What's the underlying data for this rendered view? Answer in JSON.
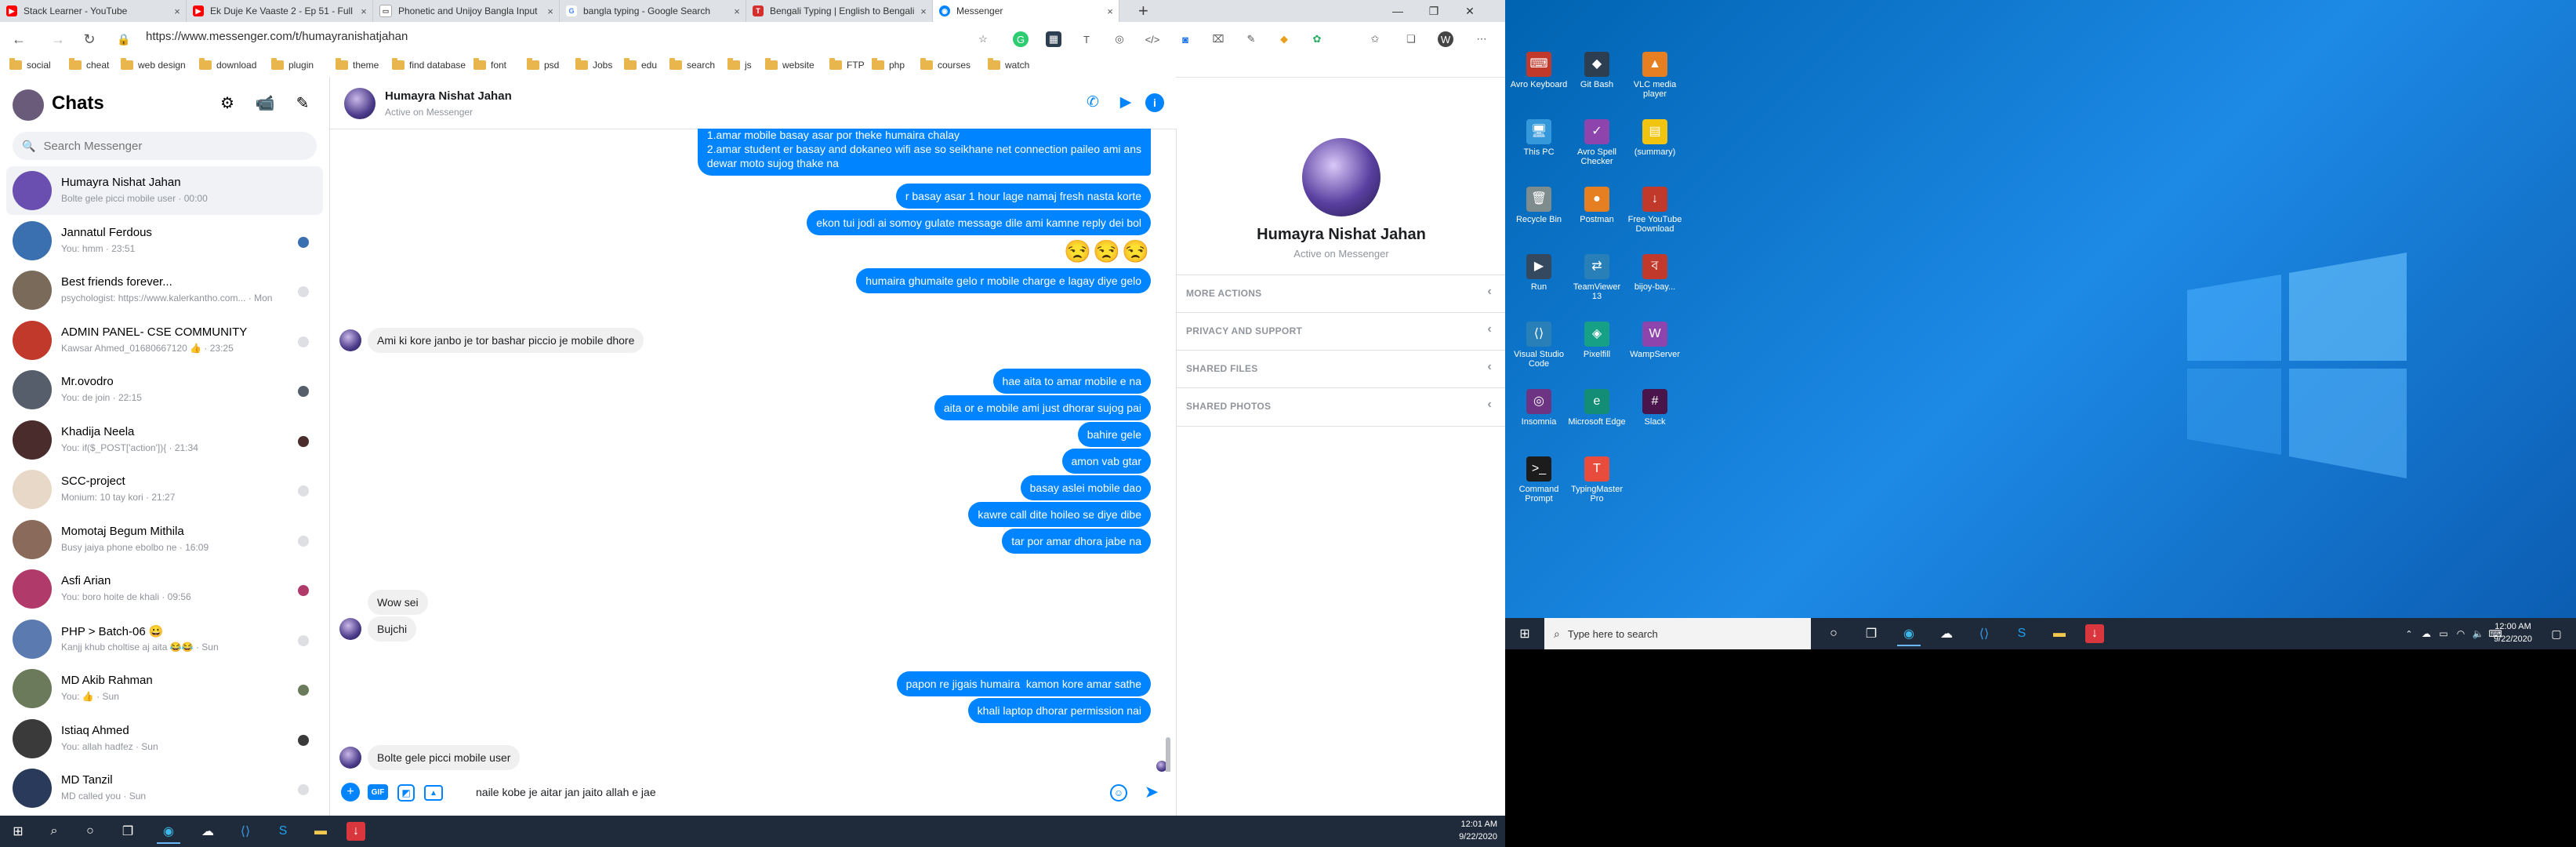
{
  "browser": {
    "tabs": [
      {
        "title": "Stack Learner - YouTube",
        "color": "#ff0000",
        "glyph": "▶"
      },
      {
        "title": "Ek Duje Ke Vaaste 2 - Ep 51 - Full",
        "color": "#ff0000",
        "glyph": "▶"
      },
      {
        "title": "Phonetic and Unijoy Bangla Input",
        "color": "#ffffff",
        "glyph": "📄"
      },
      {
        "title": "bangla typing - Google Search",
        "color": "#ffffff",
        "glyph": "G"
      },
      {
        "title": "Bengali Typing | English to Bengali",
        "color": "#d32f2f",
        "glyph": "T"
      },
      {
        "title": "Messenger",
        "color": "#0084ff",
        "glyph": "◉"
      }
    ],
    "url": "https://www.messenger.com/t/humayranishatjahan",
    "bookmarks": [
      "social",
      "cheat",
      "web design",
      "download",
      "plugin",
      "theme",
      "find database",
      "font",
      "psd",
      "Jobs",
      "edu",
      "search",
      "js",
      "website",
      "FTP",
      "php",
      "courses",
      "watch"
    ]
  },
  "sidebar": {
    "title": "Chats",
    "search_placeholder": "Search Messenger",
    "conversations": [
      {
        "name": "Humayra Nishat Jahan",
        "preview": "Bolte gele picci mobile user · 00:00",
        "avatar_color": "#6a4fb0"
      },
      {
        "name": "Jannatul Ferdous",
        "preview": "You: hmm · 23:51",
        "avatar_color": "#3a6fb0"
      },
      {
        "name": "Best friends forever...",
        "preview": "psychologist: https://www.kalerkantho.com... · Mon",
        "avatar_color": "#7a6a5a"
      },
      {
        "name": "ADMIN PANEL- CSE COMMUNITY",
        "preview": "Kawsar Ahmed_01680667120 👍 · 23:25",
        "avatar_color": "#c0392b"
      },
      {
        "name": "Mr.ovodro",
        "preview": "You: de join · 22:15",
        "avatar_color": "#555e6a"
      },
      {
        "name": "Khadija Neela",
        "preview": "You: if($_POST['action']){ · 21:34",
        "avatar_color": "#4a2c2c"
      },
      {
        "name": "SCC-project",
        "preview": "Monium: 10 tay kori · 21:27",
        "avatar_color": "#e8d8c8"
      },
      {
        "name": "Momotaj Begum Mithila",
        "preview": "Busy jaiya phone ebolbo ne · 16:09",
        "avatar_color": "#8a6a5a"
      },
      {
        "name": "Asfi Arian",
        "preview": "You: boro hoite de khali · 09:56",
        "avatar_color": "#b03a6a"
      },
      {
        "name": "PHP > Batch-06 😀",
        "preview": "Kanjj khub choltise aj aita 😂😂 · Sun",
        "avatar_color": "#5a7ab0"
      },
      {
        "name": "MD Akib Rahman",
        "preview": "You: 👍 · Sun",
        "avatar_color": "#6a7a5a"
      },
      {
        "name": "Istiaq Ahmed",
        "preview": "You: allah hadfez · Sun",
        "avatar_color": "#3a3a3a"
      },
      {
        "name": "MD Tanzil",
        "preview": "MD called you · Sun",
        "avatar_color": "#2a3a5a"
      }
    ]
  },
  "chat": {
    "name": "Humayra Nishat Jahan",
    "status": "Active on Messenger",
    "messages": [
      {
        "dir": "out",
        "text": "1.amar mobile basay asar por theke humaira chalay\n2.amar student er basay and dokaneo wifi ase so seikhane net connection paileo ami ans\ndewar moto sujog thake na"
      },
      {
        "dir": "out",
        "text": "r basay asar 1 hour lage namaj fresh nasta korte"
      },
      {
        "dir": "out",
        "text": "ekon tui jodi ai somoy gulate message dile ami kamne reply dei bol"
      },
      {
        "dir": "out",
        "text": "😒😒😒"
      },
      {
        "dir": "out",
        "text": "humaira ghumaite gelo r mobile charge e lagay diye gelo"
      },
      {
        "dir": "in",
        "text": "Ami ki kore janbo je tor bashar piccio je mobile dhore"
      },
      {
        "dir": "out",
        "text": "hae aita to amar mobile e na"
      },
      {
        "dir": "out",
        "text": "aita or e mobile ami just dhorar sujog pai"
      },
      {
        "dir": "out",
        "text": "bahire gele"
      },
      {
        "dir": "out",
        "text": "amon vab gtar"
      },
      {
        "dir": "out",
        "text": "basay aslei mobile dao"
      },
      {
        "dir": "out",
        "text": "kawre call dite hoileo se diye dibe"
      },
      {
        "dir": "out",
        "text": "tar por amar dhora jabe na"
      },
      {
        "dir": "in",
        "text": "Wow sei"
      },
      {
        "dir": "in",
        "text": "Bujchi"
      },
      {
        "dir": "out",
        "text": "papon re jigais humaira  kamon kore amar sathe"
      },
      {
        "dir": "out",
        "text": "khali laptop dhorar permission nai"
      },
      {
        "dir": "in",
        "text": "Bolte gele picci mobile user"
      }
    ],
    "composer_text": "naile kobe je aitar jan jaito allah e jae"
  },
  "info_panel": {
    "name": "Humayra Nishat Jahan",
    "status": "Active on Messenger",
    "sections": [
      "MORE ACTIONS",
      "PRIVACY AND SUPPORT",
      "SHARED FILES",
      "SHARED PHOTOS"
    ]
  },
  "taskbar_left": {
    "time": "12:01 AM",
    "date": "9/22/2020"
  },
  "desktop": {
    "icons": [
      {
        "label": "Avro Keyboard",
        "color": "#c0392b"
      },
      {
        "label": "Git Bash",
        "color": "#2c3e50"
      },
      {
        "label": "VLC media player",
        "color": "#e67e22"
      },
      {
        "label": "This PC",
        "color": "#3498db"
      },
      {
        "label": "Avro Spell Checker",
        "color": "#8e44ad"
      },
      {
        "label": "(summary)",
        "color": "#f1c40f"
      },
      {
        "label": "Recycle Bin",
        "color": "#7f8c8d"
      },
      {
        "label": "Postman",
        "color": "#e67e22"
      },
      {
        "label": "Free YouTube Download",
        "color": "#c0392b"
      },
      {
        "label": "Run",
        "color": "#34495e"
      },
      {
        "label": "TeamViewer 13",
        "color": "#2980b9"
      },
      {
        "label": "bijoy-bay...",
        "color": "#c0392b"
      },
      {
        "label": "Visual Studio Code",
        "color": "#2980b9"
      },
      {
        "label": "Pixelfill",
        "color": "#16a085"
      },
      {
        "label": "WampServer",
        "color": "#8e44ad"
      },
      {
        "label": "Insomnia",
        "color": "#6c3483"
      },
      {
        "label": "Microsoft Edge",
        "color": "#138d75"
      },
      {
        "label": "Slack",
        "color": "#4a154b"
      },
      {
        "label": "Command Prompt",
        "color": "#1c1c1c"
      },
      {
        "label": "TypingMaster Pro",
        "color": "#e74c3c"
      }
    ],
    "search_placeholder": "Type here to search",
    "time": "12:00 AM",
    "date": "9/22/2020"
  }
}
